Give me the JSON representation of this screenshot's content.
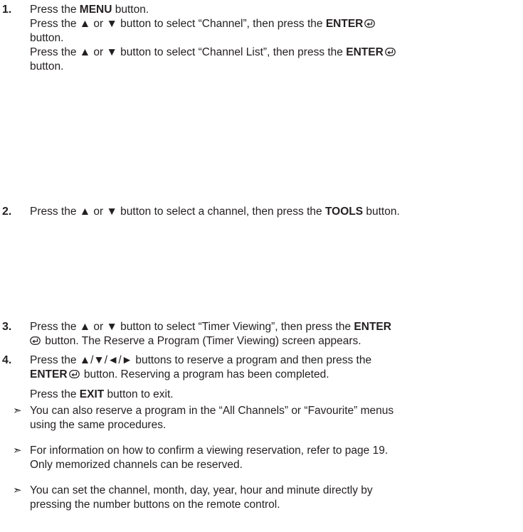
{
  "step1": {
    "number": "1.",
    "l1_a": "Press the ",
    "l1_b": "MENU",
    "l1_c": " button.",
    "l2_a": "Press the ▲ or ▼ button to select “Channel”, then press the ",
    "l2_b": "ENTER",
    "l3": "button.",
    "l4_a": "Press the ▲ or ▼ button to select “Channel List”, then press the ",
    "l4_b": "ENTER",
    "l5": "button."
  },
  "step2": {
    "number": "2.",
    "a": "Press the ▲ or ▼ button to select a channel, then press the ",
    "b": "TOOLS",
    "c": " button."
  },
  "step3": {
    "number": "3.",
    "l1_a": "Press the ▲ or ▼ button to select “Timer Viewing”, then press the ",
    "l1_b": "ENTER",
    "l2": " button. The Reserve a Program (Timer Viewing) screen appears."
  },
  "step4": {
    "number": "4.",
    "l1": "Press the ▲/▼/◄/► buttons to reserve a program and then press the",
    "l2_b": "ENTER",
    "l2_c": " button. Reserving a program has been completed.",
    "l3_a": "Press the ",
    "l3_b": "EXIT",
    "l3_c": " button to exit."
  },
  "notes": {
    "marker": "➣",
    "n1_l1": "You can also reserve a program in the “All Channels” or “Favourite” menus",
    "n1_l2": "using the same procedures.",
    "n2_l1": "For information on how to confirm a viewing reservation, refer to page 19.",
    "n2_l2": "Only memorized channels can be reserved.",
    "n3_l1": "You can set the channel, month, day, year, hour and minute directly by",
    "n3_l2": "pressing the number buttons on the remote control."
  },
  "icons": {
    "enter": "enter-icon"
  }
}
